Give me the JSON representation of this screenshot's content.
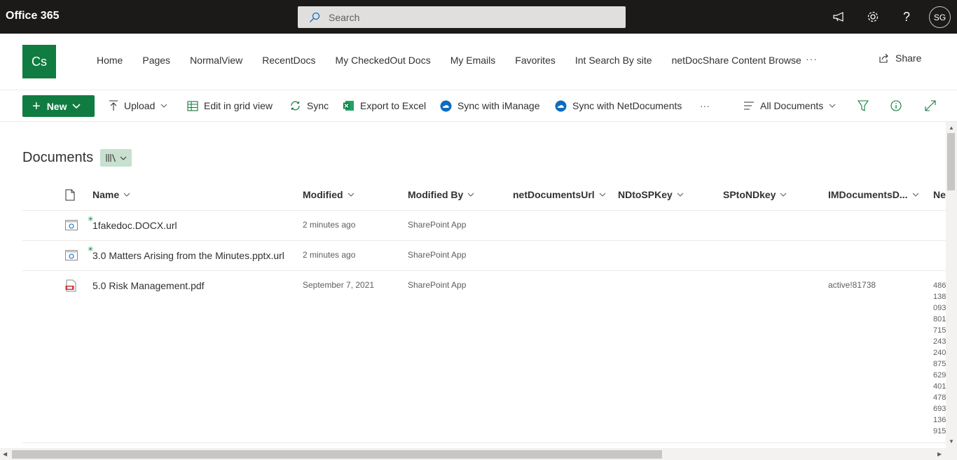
{
  "suite": {
    "app_title": "Office 365",
    "search_placeholder": "Search",
    "avatar_initials": "SG"
  },
  "site": {
    "logo_text": "Cs",
    "nav": [
      "Home",
      "Pages",
      "NormalView",
      "RecentDocs",
      "My CheckedOut Docs",
      "My Emails",
      "Favorites",
      "Int Search By site",
      "netDocShare Content Browse"
    ],
    "nav_more": "···",
    "share_label": "Share"
  },
  "commandbar": {
    "new_label": "New",
    "upload_label": "Upload",
    "grid_label": "Edit in grid view",
    "sync_label": "Sync",
    "excel_label": "Export to Excel",
    "imanage_label": "Sync with iManage",
    "netdocs_label": "Sync with NetDocuments",
    "more_label": "···",
    "view_label": "All Documents"
  },
  "library": {
    "title": "Documents",
    "columns": {
      "name": "Name",
      "modified": "Modified",
      "modified_by": "Modified By",
      "netdocs_url": "netDocumentsUrl",
      "nd_to_sp": "NDtoSPKey",
      "sp_to_nd": "SPtoNDkey",
      "im_documents": "IMDocumentsD...",
      "next": "Ne"
    },
    "rows": [
      {
        "name": "1fakedoc.DOCX.url",
        "modified": "2 minutes ago",
        "modified_by": "SharePoint App",
        "im": ""
      },
      {
        "name": "3.0 Matters Arising from the Minutes.pptx.url",
        "modified": "2 minutes ago",
        "modified_by": "SharePoint App",
        "im": ""
      },
      {
        "name": "5.0 Risk Management.pdf",
        "modified": "September 7, 2021",
        "modified_by": "SharePoint App",
        "im": "active!81738"
      }
    ],
    "truncated_ids": [
      "486",
      "138",
      "093",
      "801",
      "715",
      "243",
      "240",
      "875",
      "629",
      "401",
      "478",
      "693",
      "136",
      "915"
    ]
  },
  "colors": {
    "suitebar": "#1b1a19",
    "accent": "#107c41",
    "view_btn": "#c7e0d0",
    "sync_blue": "#0f6cbd"
  }
}
